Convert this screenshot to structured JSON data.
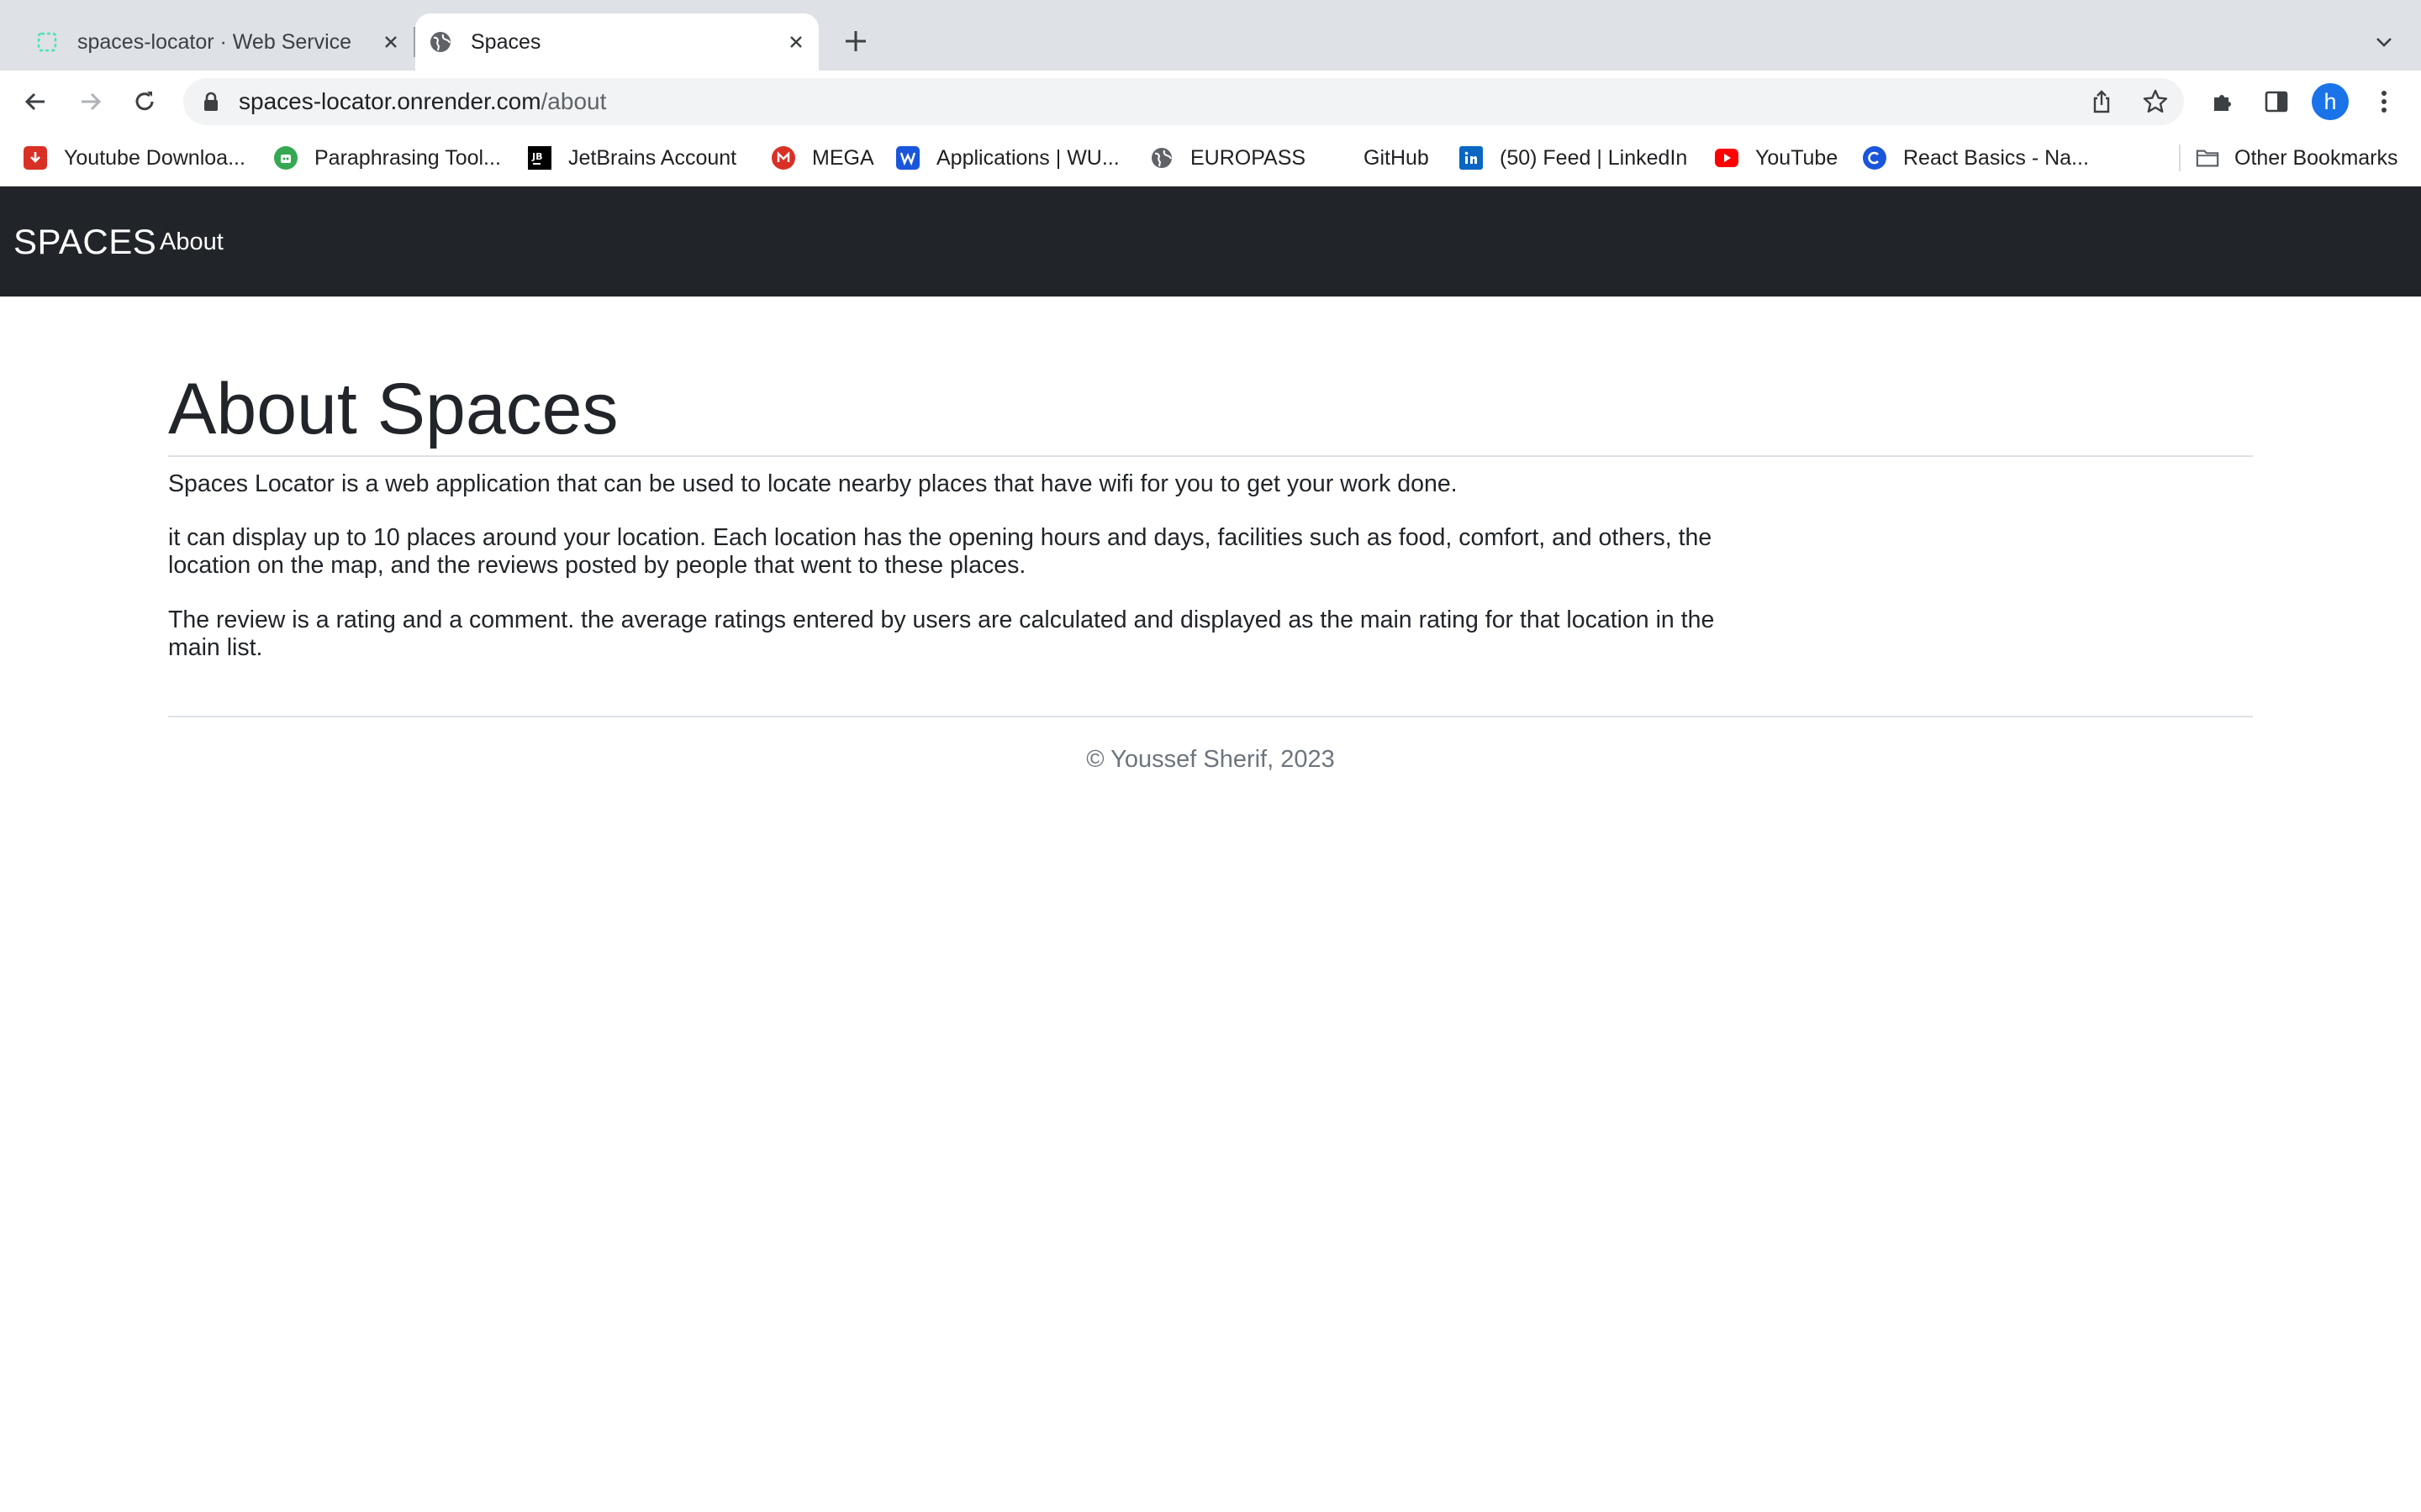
{
  "browser": {
    "tabs": [
      {
        "title": "spaces-locator · Web Service",
        "active": false,
        "icon": "render-icon"
      },
      {
        "title": "Spaces",
        "active": true,
        "icon": "globe-icon"
      }
    ],
    "address": {
      "host": "spaces-locator.onrender.com",
      "path": "/about"
    },
    "profile_initial": "h",
    "bookmarks": [
      {
        "label": "Youtube Downloa...",
        "icon": "download-icon",
        "color": "#d93025"
      },
      {
        "label": "Paraphrasing Tool...",
        "icon": "robot-icon",
        "color": "#34a853"
      },
      {
        "label": "JetBrains Account",
        "icon": "jetbrains-icon",
        "color": "#000000"
      },
      {
        "label": "MEGA",
        "icon": "mega-icon",
        "color": "#d93025"
      },
      {
        "label": "Applications | WU...",
        "icon": "w-icon",
        "color": "#1a56db"
      },
      {
        "label": "EUROPASS",
        "icon": "globe-icon",
        "color": "#5f6368"
      },
      {
        "label": "GitHub",
        "icon": "github-icon",
        "color": "#ffffff"
      },
      {
        "label": "(50) Feed | LinkedIn",
        "icon": "linkedin-icon",
        "color": "#0a66c2"
      },
      {
        "label": "YouTube",
        "icon": "youtube-icon",
        "color": "#ff0000"
      },
      {
        "label": "React Basics - Na...",
        "icon": "c-icon",
        "color": "#1a56db"
      }
    ],
    "other_bookmarks": "Other Bookmarks"
  },
  "site": {
    "brand": "SPACES",
    "nav": {
      "about": "About"
    },
    "navbar_color": "#212529"
  },
  "about": {
    "title": "About Spaces",
    "paragraphs": [
      "Spaces Locator is a web application that can be used to locate nearby places that have wifi for you to get your work done.",
      "it can display up to 10 places around your location. Each location has the opening hours and days, facilities such as food, comfort, and others, the location on the map, and the reviews posted by people that went to these places.",
      "The review is a rating and a comment. the average ratings entered by users are calculated and displayed as the main rating for that location in the main list."
    ]
  },
  "footer": {
    "text": "© Youssef Sherif, 2023"
  }
}
